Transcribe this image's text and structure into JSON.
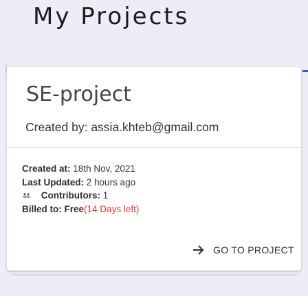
{
  "page": {
    "title": "My Projects"
  },
  "project": {
    "name": "SE-project",
    "created_by": "Created by: assia.khteb@gmail.com",
    "created_at_label": "Created at:",
    "created_at_value": "18th Nov, 2021",
    "last_updated_label": "Last Updated:",
    "last_updated_value": "2 hours ago",
    "contributors_label": "Contributors:",
    "contributors_value": "1",
    "billed_label": "Billed to:",
    "billed_plan": "Free",
    "billed_days_left": "(14 Days left)",
    "goto_label": "GO TO PROJECT"
  },
  "icons": {
    "contributors": "people-icon",
    "goto": "arrow-right-icon"
  },
  "colors": {
    "background": "#ecedf7",
    "accent_red": "#e53935",
    "accent_blue": "#3a57b8"
  }
}
